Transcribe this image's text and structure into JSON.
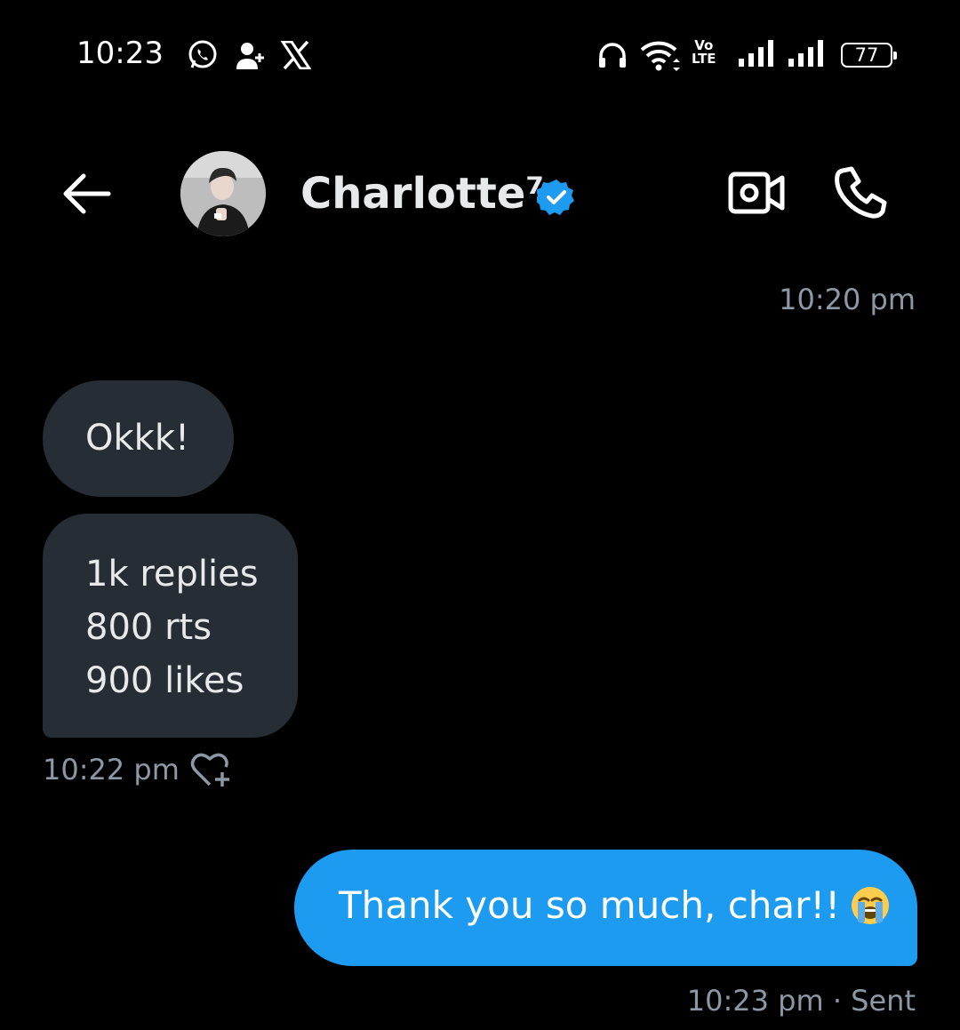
{
  "status_bar": {
    "time": "10:23",
    "battery": "77",
    "volte_line1": "Vo",
    "volte_line2": "LTE"
  },
  "header": {
    "contact_name": "Charlotte⁷",
    "verified": true
  },
  "messages": {
    "top_timestamp": "10:20 pm",
    "received": [
      {
        "lines": [
          "Okkk!"
        ]
      },
      {
        "lines": [
          "1k replies",
          "800 rts",
          "900 likes"
        ]
      }
    ],
    "received_timestamp": "10:22 pm",
    "sent": {
      "text": "Thank you so much, char!!",
      "emoji": "loudly-crying-face"
    },
    "sent_status": "10:23 pm · Sent"
  },
  "colors": {
    "background": "#000000",
    "received_bubble": "#262d34",
    "sent_bubble": "#1d9bf0",
    "verified_badge": "#1d9bf0",
    "timestamp": "#8b98a5"
  }
}
